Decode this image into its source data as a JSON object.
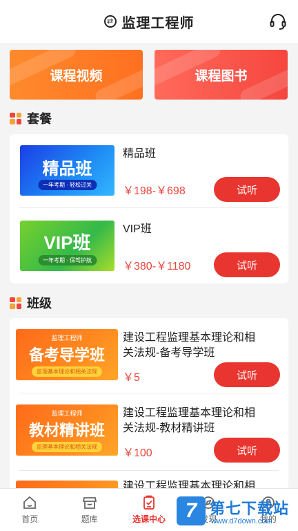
{
  "header": {
    "title": "监理工程师",
    "swap_icon": "swap-icon",
    "support_icon": "headset-icon"
  },
  "banners": {
    "video": "课程视频",
    "books": "课程图书"
  },
  "packages": {
    "title": "套餐",
    "items": [
      {
        "thumb_main": "精品班",
        "thumb_sub": "一年考期 · 轻松过关",
        "name": "精品班",
        "price": "￥198-￥698",
        "button": "试听"
      },
      {
        "thumb_main": "VIP班",
        "thumb_sub": "一年考期 · 保驾护航",
        "name": "VIP班",
        "price": "￥380-￥1180",
        "button": "试听"
      }
    ]
  },
  "classes": {
    "title": "班级",
    "items": [
      {
        "thumb_tag": "监理工程师",
        "thumb_main": "备考导学班",
        "thumb_sub": "监理基本理论和相关法规",
        "name_line1": "建设工程监理基本理论和相",
        "name_line2": "关法规-备考导学班",
        "price": "￥5",
        "button": "试听"
      },
      {
        "thumb_tag": "监理工程师",
        "thumb_main": "教材精讲班",
        "thumb_sub": "监理基本理论和相关法规",
        "name_line1": "建设工程监理基本理论和相",
        "name_line2": "关法规-教材精讲班",
        "price": "￥100",
        "button": "试听"
      },
      {
        "name_line1": "建设工程监理基本理论和相"
      }
    ]
  },
  "tabs": [
    {
      "label": "首页",
      "icon": "home-icon"
    },
    {
      "label": "题库",
      "icon": "store-icon"
    },
    {
      "label": "选课中心",
      "icon": "checklist-icon",
      "active": true
    },
    {
      "label": "发现",
      "icon": "discover-icon"
    },
    {
      "label": "我的",
      "icon": "user-icon"
    }
  ],
  "watermark": {
    "logo": "7",
    "name": "第七下载站",
    "url": "www.d7down.com"
  },
  "colors": {
    "accent": "#e8352f",
    "price": "#e8453c",
    "orange": "#ff8a2c"
  }
}
